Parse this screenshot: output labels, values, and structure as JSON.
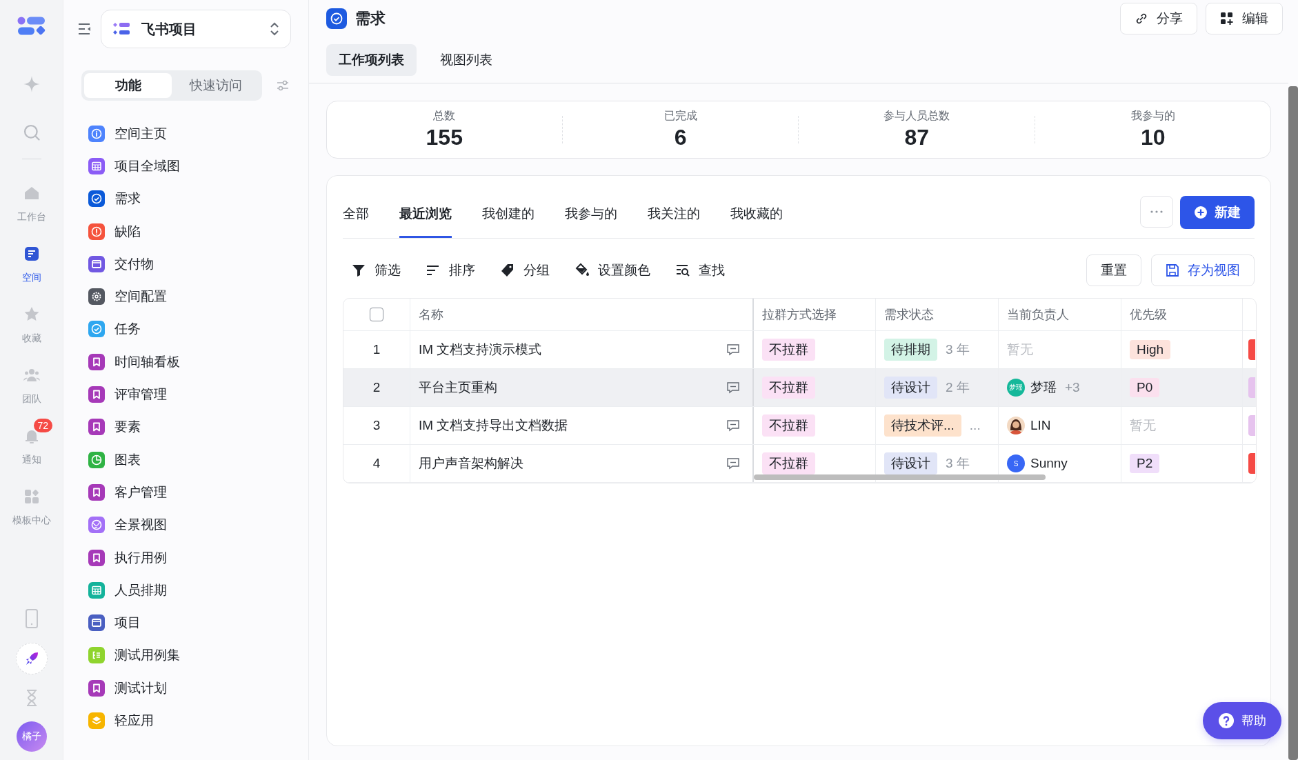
{
  "rail": {
    "items": [
      {
        "label": "工作台",
        "kind": "home",
        "selected": false
      },
      {
        "label": "空间",
        "kind": "space",
        "selected": true
      },
      {
        "label": "收藏",
        "kind": "star",
        "selected": false
      },
      {
        "label": "团队",
        "kind": "team",
        "selected": false
      },
      {
        "label": "通知",
        "kind": "bell",
        "selected": false,
        "badge": "72"
      },
      {
        "label": "模板中心",
        "kind": "apps",
        "selected": false
      }
    ],
    "avatar": "橘子"
  },
  "sidebar": {
    "project": "飞书项目",
    "segments": [
      {
        "label": "功能",
        "selected": true
      },
      {
        "label": "快速访问",
        "selected": false
      }
    ],
    "items": [
      {
        "label": "空间主页",
        "kind": "info",
        "color": "#4e83fd"
      },
      {
        "label": "项目全域图",
        "kind": "grid",
        "color": "#8b5cf6"
      },
      {
        "label": "需求",
        "kind": "check",
        "color": "#0b5ad9"
      },
      {
        "label": "缺陷",
        "kind": "alert",
        "color": "#f5533d"
      },
      {
        "label": "交付物",
        "kind": "box",
        "color": "#7158e2"
      },
      {
        "label": "空间配置",
        "kind": "gear",
        "color": "#545861"
      },
      {
        "label": "任务",
        "kind": "check",
        "color": "#2ea7f0"
      },
      {
        "label": "时间轴看板",
        "kind": "bookmark",
        "color": "#a639b8"
      },
      {
        "label": "评审管理",
        "kind": "bookmark",
        "color": "#a639b8"
      },
      {
        "label": "要素",
        "kind": "bookmark",
        "color": "#a639b8"
      },
      {
        "label": "图表",
        "kind": "pie",
        "color": "#2fb344"
      },
      {
        "label": "客户管理",
        "kind": "bookmark",
        "color": "#a639b8"
      },
      {
        "label": "全景视图",
        "kind": "globe",
        "color": "#a370f7"
      },
      {
        "label": "执行用例",
        "kind": "bookmark",
        "color": "#a639b8"
      },
      {
        "label": "人员排期",
        "kind": "grid",
        "color": "#14b39b"
      },
      {
        "label": "项目",
        "kind": "box",
        "color": "#4a5fc1"
      },
      {
        "label": "测试用例集",
        "kind": "list",
        "color": "#8fd42e"
      },
      {
        "label": "测试计划",
        "kind": "bookmark",
        "color": "#a639b8"
      },
      {
        "label": "轻应用",
        "kind": "layers",
        "color": "#f7b500"
      }
    ]
  },
  "page": {
    "title": "需求",
    "actions": [
      {
        "label": "分享",
        "kind": "link"
      },
      {
        "label": "编辑",
        "kind": "edit"
      }
    ],
    "tabs": [
      {
        "label": "工作项列表",
        "selected": true
      },
      {
        "label": "视图列表",
        "selected": false
      }
    ],
    "stats": [
      {
        "label": "总数",
        "value": "155"
      },
      {
        "label": "已完成",
        "value": "6"
      },
      {
        "label": "参与人员总数",
        "value": "87"
      },
      {
        "label": "我参与的",
        "value": "10"
      }
    ]
  },
  "views": {
    "tabs": [
      {
        "label": "全部",
        "selected": false
      },
      {
        "label": "最近浏览",
        "selected": true
      },
      {
        "label": "我创建的",
        "selected": false
      },
      {
        "label": "我参与的",
        "selected": false
      },
      {
        "label": "我关注的",
        "selected": false
      },
      {
        "label": "我收藏的",
        "selected": false
      }
    ],
    "new_button": "新建"
  },
  "toolbar": {
    "tools": [
      {
        "label": "筛选",
        "kind": "filter"
      },
      {
        "label": "排序",
        "kind": "sort"
      },
      {
        "label": "分组",
        "kind": "tag"
      },
      {
        "label": "设置颜色",
        "kind": "paint"
      },
      {
        "label": "查找",
        "kind": "find"
      }
    ],
    "reset": "重置",
    "save_view": "存为视图"
  },
  "table": {
    "select_all": {
      "checked": false
    },
    "columns": [
      "名称",
      "拉群方式选择",
      "需求状态",
      "当前负责人",
      "优先级"
    ],
    "rows": [
      {
        "number": "1",
        "name": "IM 文档支持演示模式",
        "highlighted": false,
        "group_mode": "不拉群",
        "status": {
          "label": "待排期",
          "color": "#d3f3e6"
        },
        "age": "3 年",
        "owner": {
          "kind": "none",
          "name": "暂无"
        },
        "priority": {
          "kind": "tag",
          "label": "High",
          "color": "#fde3dc"
        },
        "column_6": {
          "color": "#f54a45"
        }
      },
      {
        "number": "2",
        "name": "平台主页重构",
        "highlighted": true,
        "group_mode": "不拉群",
        "status": {
          "label": "待设计",
          "color": "#e1e5f7"
        },
        "age": "2 年",
        "owner": {
          "kind": "initials",
          "initials": "梦瑶",
          "color": "#15b89a",
          "name": "梦瑶",
          "extra": "+3"
        },
        "priority": {
          "kind": "tag",
          "label": "P0",
          "color": "#fbe0ee"
        },
        "column_6": {
          "color": "#e6c3ee"
        }
      },
      {
        "number": "3",
        "name": "IM 文档支持导出文档数据",
        "highlighted": false,
        "group_mode": "不拉群",
        "status": {
          "label": "待技术评...",
          "color": "#fde2cc"
        },
        "age": "...",
        "owner": {
          "name": "LIN"
        },
        "priority": {
          "kind": "none",
          "label": "暂无"
        },
        "column_6": {
          "color": "#e6c3ee"
        }
      },
      {
        "number": "4",
        "name": "用户声音架构解决",
        "highlighted": false,
        "group_mode": "不拉群",
        "status": {
          "label": "待设计",
          "color": "#e1e5f7"
        },
        "age": "3 年",
        "owner": {
          "kind": "initials",
          "initials": "S",
          "color": "#3867f5",
          "name": "Sunny"
        },
        "priority": {
          "kind": "tag",
          "label": "P2",
          "color": "#f0defa"
        },
        "column_6": {
          "color": "#f54a45"
        }
      }
    ]
  },
  "help": "帮助"
}
